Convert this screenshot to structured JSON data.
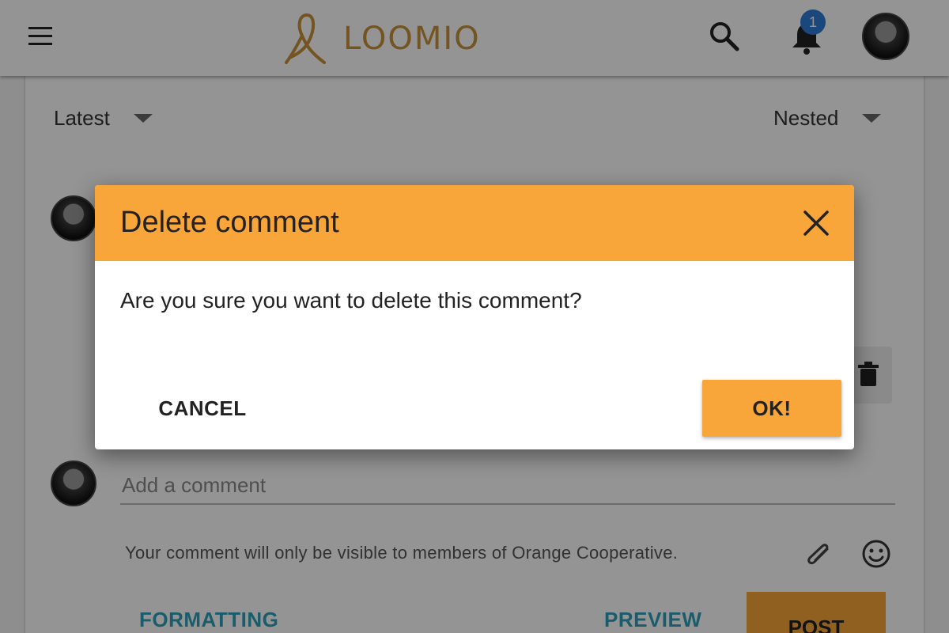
{
  "app": {
    "logo_text": "LOOMIO",
    "brand_color": "#c8913a",
    "accent_color": "#f8a53a"
  },
  "header": {
    "notification_count": "1",
    "icons": [
      "menu-icon",
      "search-icon",
      "bell-icon",
      "avatar"
    ]
  },
  "thread": {
    "sort_order": "Latest",
    "view_mode": "Nested"
  },
  "composer": {
    "placeholder": "Add a comment",
    "visibility_note": "Your comment will only be visible to members of Orange Cooperative.",
    "formatting_label": "FORMATTING",
    "preview_label": "PREVIEW",
    "post_label": "POST"
  },
  "dialog": {
    "title": "Delete comment",
    "message": "Are you sure you want to delete this comment?",
    "cancel_label": "CANCEL",
    "ok_label": "OK!"
  }
}
